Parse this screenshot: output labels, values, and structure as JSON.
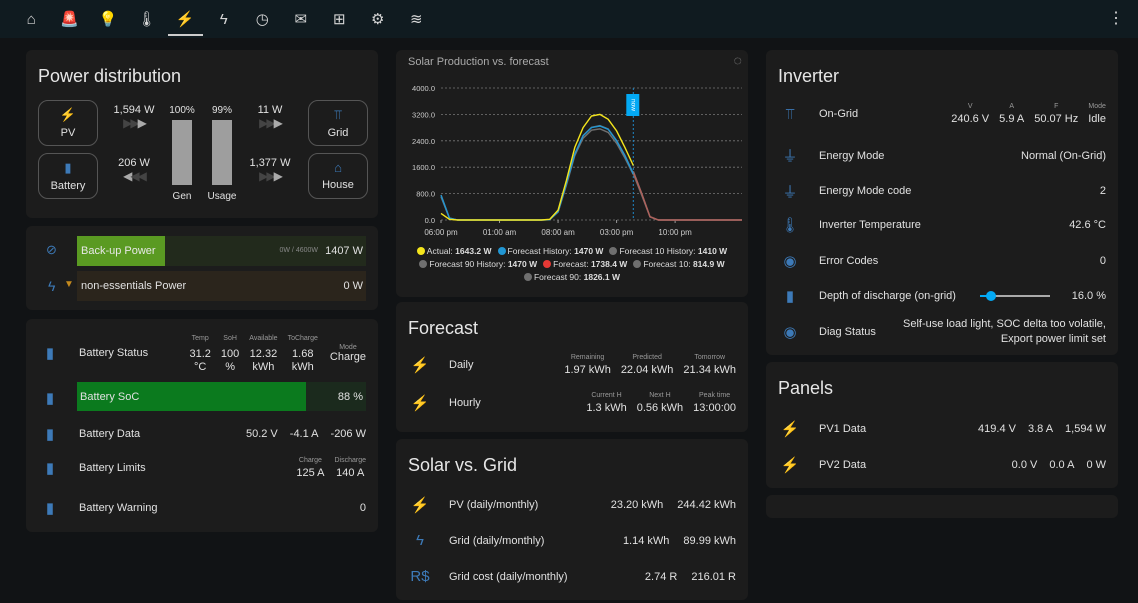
{
  "nav": {
    "tabs": [
      {
        "icon": "home-icon",
        "glyph": "⌂"
      },
      {
        "icon": "alarm-light-icon",
        "glyph": "🚨"
      },
      {
        "icon": "lightbulb-group-icon",
        "glyph": "💡"
      },
      {
        "icon": "thermometer-icon",
        "glyph": "🌡"
      },
      {
        "icon": "solar-power-icon",
        "glyph": "⚡"
      },
      {
        "icon": "lightning-bolt-icon",
        "glyph": "ϟ"
      },
      {
        "icon": "clock-icon",
        "glyph": "◷"
      },
      {
        "icon": "email-icon",
        "glyph": "✉"
      },
      {
        "icon": "network-icon",
        "glyph": "⊞"
      },
      {
        "icon": "cog-icon",
        "glyph": "⚙"
      },
      {
        "icon": "pool-icon",
        "glyph": "≋"
      }
    ],
    "active": 4,
    "menu_glyph": "⋮"
  },
  "power": {
    "title": "Power distribution",
    "pv": "PV",
    "battery": "Battery",
    "grid": "Grid",
    "house": "House",
    "pv_w": "1,594 W",
    "bat_w": "206 W",
    "grid_w": "11 W",
    "house_w": "1,377 W",
    "gen_pct": "100%",
    "usage_pct": "99%",
    "gen": "Gen",
    "usage": "Usage",
    "gen_fill": 100,
    "usage_fill": 99
  },
  "loads": {
    "backup": {
      "label": "Back-up Power",
      "range": "0W / 4600W",
      "value": "1407 W",
      "fraction": 0.306,
      "color": "#5a9a22"
    },
    "nonessential": {
      "label": "non-essentials Power",
      "value": "0 W"
    }
  },
  "battery": {
    "status": {
      "label": "Battery Status",
      "cols": [
        {
          "h": "Temp",
          "v": "31.2",
          "u": "°C"
        },
        {
          "h": "SoH",
          "v": "100",
          "u": "%"
        },
        {
          "h": "Available",
          "v": "12.32",
          "u": "kWh"
        },
        {
          "h": "ToCharge",
          "v": "1.68",
          "u": "kWh"
        }
      ],
      "mode_h": "Mode",
      "mode": "Charge"
    },
    "soc": {
      "label": "Battery SoC",
      "value": "88 %",
      "percent": 88,
      "color": "#0b7a1e"
    },
    "data": {
      "label": "Battery Data",
      "v": "50.2 V",
      "a": "-4.1 A",
      "w": "-206 W"
    },
    "limits": {
      "label": "Battery Limits",
      "charge_h": "Charge",
      "charge": "125 A",
      "discharge_h": "Discharge",
      "discharge": "140 A"
    },
    "warning": {
      "label": "Battery Warning",
      "value": "0"
    }
  },
  "chart_data": {
    "type": "line",
    "title": "Solar Production vs. forecast",
    "ylim": [
      0,
      4000
    ],
    "yticks": [
      "0.0",
      "800.0",
      "1600.0",
      "2400.0",
      "3200.0",
      "4000.0"
    ],
    "xticks": [
      "06:00 pm",
      "01:00 am",
      "08:00 am",
      "03:00 pm",
      "10:00 pm"
    ],
    "now_label": "now",
    "now": "05:00 pm",
    "x": [
      "06:00 pm",
      "07:00 pm",
      "08:00 pm",
      "09:00 pm",
      "10:00 pm",
      "11:00 pm",
      "12:00 am",
      "01:00 am",
      "02:00 am",
      "03:00 am",
      "04:00 am",
      "05:00 am",
      "06:00 am",
      "07:00 am",
      "08:00 am",
      "09:00 am",
      "10:00 am",
      "11:00 am",
      "12:00 pm",
      "01:00 pm",
      "02:00 pm",
      "03:00 pm",
      "04:00 pm",
      "05:00 pm",
      "06:00 pm",
      "07:00 pm",
      "08:00 pm",
      "09:00 pm",
      "10:00 pm",
      "11:00 pm",
      "12:00 am",
      "01:00 am",
      "02:00 am",
      "03:00 am",
      "04:00 am",
      "05:00 am",
      "06:00 am"
    ],
    "series": [
      {
        "name": "Actual",
        "current": "1643.2 W",
        "color": "#f4e51c",
        "values": [
          200,
          20,
          0,
          0,
          0,
          0,
          0,
          0,
          0,
          0,
          0,
          0,
          0,
          20,
          300,
          1200,
          2200,
          2800,
          3150,
          3200,
          3050,
          2700,
          2200,
          1650
        ]
      },
      {
        "name": "Forecast History",
        "current": "1470 W",
        "color": "#2196d3",
        "values": [
          750,
          60,
          0,
          0,
          0,
          0,
          0,
          0,
          0,
          0,
          0,
          0,
          0,
          10,
          250,
          1100,
          2000,
          2550,
          2800,
          2850,
          2750,
          2400,
          1950,
          1400
        ]
      },
      {
        "name": "Forecast 10 History",
        "current": "1410 W",
        "color": "#6f6f6f",
        "values": [
          700,
          50,
          0,
          0,
          0,
          0,
          0,
          0,
          0,
          0,
          0,
          0,
          0,
          10,
          240,
          1050,
          1950,
          2480,
          2720,
          2760,
          2650,
          2320,
          1880,
          1380
        ]
      },
      {
        "name": "Forecast 90 History",
        "current": "1470 W",
        "color": "#6f6f6f",
        "values": [
          760,
          60,
          0,
          0,
          0,
          0,
          0,
          0,
          0,
          0,
          0,
          0,
          0,
          10,
          255,
          1110,
          2010,
          2560,
          2810,
          2860,
          2760,
          2410,
          1960,
          1410
        ]
      },
      {
        "name": "Forecast",
        "current": "1738.4 W",
        "color": "#e53935",
        "offset": 23,
        "values": [
          1470,
          800,
          100,
          0,
          0,
          0,
          0,
          0,
          0,
          0,
          0,
          0,
          0,
          0
        ]
      },
      {
        "name": "Forecast 10",
        "current": "814.9 W",
        "color": "#6f6f6f",
        "offset": 23,
        "values": [
          1400,
          750,
          90,
          0,
          0,
          0,
          0,
          0,
          0,
          0,
          0,
          0,
          0,
          0
        ]
      },
      {
        "name": "Forecast 90",
        "current": "1826.1 W",
        "color": "#6f6f6f",
        "offset": 23,
        "values": [
          1480,
          810,
          100,
          0,
          0,
          0,
          0,
          0,
          0,
          0,
          0,
          0,
          0,
          0
        ]
      }
    ]
  },
  "forecast": {
    "title": "Forecast",
    "daily": {
      "label": "Daily",
      "cols": [
        {
          "h": "Remaining",
          "v": "1.97 kWh"
        },
        {
          "h": "Predicted",
          "v": "22.04 kWh"
        },
        {
          "h": "Tomorrow",
          "v": "21.34 kWh"
        }
      ]
    },
    "hourly": {
      "label": "Hourly",
      "cols": [
        {
          "h": "Current H",
          "v": "1.3 kWh"
        },
        {
          "h": "Next H",
          "v": "0.56 kWh"
        },
        {
          "h": "Peak time",
          "v": "13:00:00"
        }
      ]
    }
  },
  "solar_grid": {
    "title": "Solar vs. Grid",
    "rows": [
      {
        "label": "PV (daily/monthly)",
        "d": "23.20 kWh",
        "m": "244.42 kWh"
      },
      {
        "label": "Grid (daily/monthly)",
        "d": "1.14 kWh",
        "m": "89.99 kWh"
      },
      {
        "label": "Grid cost (daily/monthly)",
        "d": "2.74 R",
        "m": "216.01 R",
        "icon_text": "R$"
      }
    ]
  },
  "inverter": {
    "title": "Inverter",
    "ongrid": {
      "label": "On-Grid",
      "cols": [
        {
          "h": "V",
          "v": "240.6 V"
        },
        {
          "h": "A",
          "v": "5.9 A"
        },
        {
          "h": "F",
          "v": "50.07 Hz"
        },
        {
          "h": "Mode",
          "v": "Idle"
        }
      ]
    },
    "rows": [
      {
        "label": "Energy Mode",
        "value": "Normal (On-Grid)"
      },
      {
        "label": "Energy Mode code",
        "value": "2"
      },
      {
        "label": "Inverter Temperature",
        "value": "42.6 °C"
      },
      {
        "label": "Error Codes",
        "value": "0"
      }
    ],
    "dod": {
      "label": "Depth of discharge (on-grid)",
      "value": "16.0 %",
      "percent": 16
    },
    "diag": {
      "label": "Diag Status",
      "value1": "Self-use load light, SOC delta too volatile,",
      "value2": "Export power limit set"
    }
  },
  "panels": {
    "title": "Panels",
    "rows": [
      {
        "label": "PV1 Data",
        "v": "419.4 V",
        "a": "3.8 A",
        "w": "1,594 W"
      },
      {
        "label": "PV2 Data",
        "v": "0.0 V",
        "a": "0.0 A",
        "w": "0 W"
      }
    ]
  }
}
